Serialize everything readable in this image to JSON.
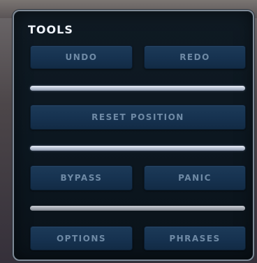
{
  "panel": {
    "title": "TOOLS"
  },
  "buttons": {
    "undo": "UNDO",
    "redo": "REDO",
    "reset_position": "RESET POSITION",
    "bypass": "BYPASS",
    "panic": "PANIC",
    "options": "OPTIONS",
    "phrases": "PHRASES"
  },
  "colors": {
    "panel_bg": "#0c1720",
    "panel_border": "#7f8a97",
    "button_bg": "#163250",
    "button_text": "#6f8aa5",
    "title_text": "#eef3fa",
    "divider": "#c4cde0"
  }
}
